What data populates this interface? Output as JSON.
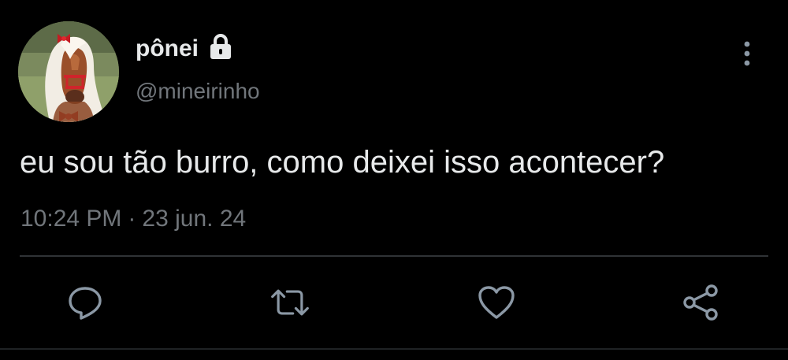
{
  "user": {
    "display_name": "pônei",
    "handle": "@mineirinho",
    "avatar_icon": "pony-avatar",
    "protected_icon": "lock-icon"
  },
  "tweet": {
    "text": "eu sou tão burro, como deixei isso acontecer?",
    "time": "10:24 PM",
    "separator": "·",
    "date": "23 jun. 24"
  },
  "actions": {
    "reply_icon": "reply-icon",
    "retweet_icon": "retweet-icon",
    "like_icon": "heart-icon",
    "share_icon": "share-icon",
    "more_icon": "more-vertical-icon"
  },
  "colors": {
    "background": "#000000",
    "text_primary": "#e7e9ea",
    "text_secondary": "#71767b",
    "icon": "#8b98a5",
    "divider": "#2f3336"
  }
}
